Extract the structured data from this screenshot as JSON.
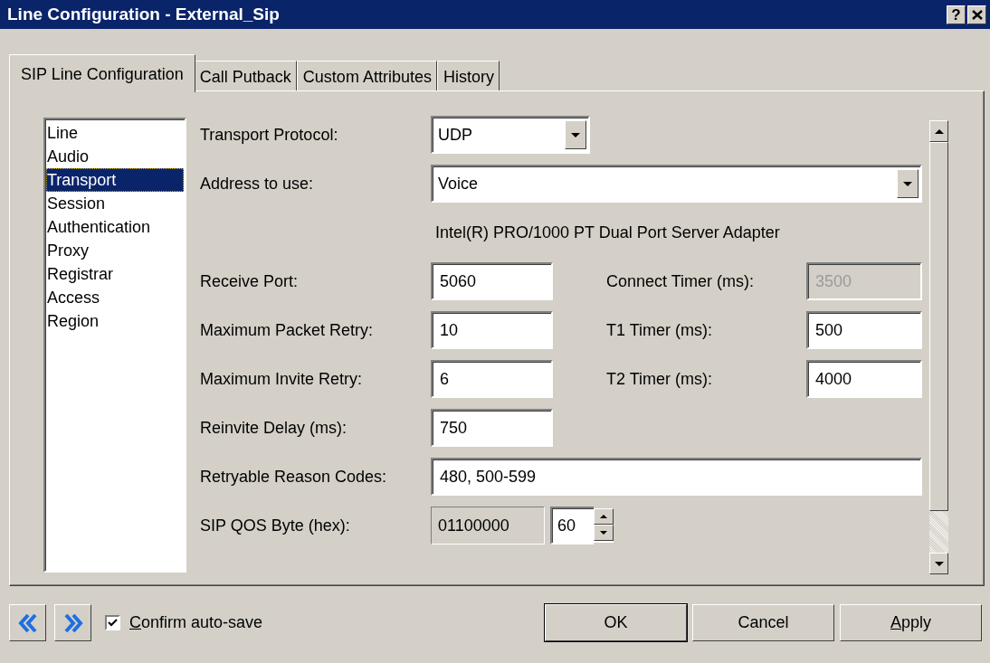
{
  "window": {
    "title": "Line Configuration - External_Sip",
    "help_button": "?"
  },
  "tabs": [
    {
      "label": "SIP Line Configuration",
      "selected": true
    },
    {
      "label": "Call Putback",
      "selected": false
    },
    {
      "label": "Custom Attributes",
      "selected": false
    },
    {
      "label": "History",
      "selected": false
    }
  ],
  "sections": [
    {
      "label": "Line",
      "selected": false
    },
    {
      "label": "Audio",
      "selected": false
    },
    {
      "label": "Transport",
      "selected": true
    },
    {
      "label": "Session",
      "selected": false
    },
    {
      "label": "Authentication",
      "selected": false
    },
    {
      "label": "Proxy",
      "selected": false
    },
    {
      "label": "Registrar",
      "selected": false
    },
    {
      "label": "Access",
      "selected": false
    },
    {
      "label": "Region",
      "selected": false
    }
  ],
  "form_rows": [
    {
      "fields": [
        {
          "kind": "dropdown",
          "label": "Transport Protocol:",
          "value": "UDP"
        }
      ]
    },
    {
      "fields": [
        {
          "kind": "wide_dropdown",
          "label": "Address to use:",
          "value": "Voice"
        }
      ]
    },
    {
      "fields": [
        {
          "kind": "note",
          "value": "Intel(R) PRO/1000 PT Dual Port Server Adapter"
        }
      ]
    },
    {
      "fields": [
        {
          "kind": "input",
          "label": "Receive Port:",
          "value": "5060",
          "disabled": false
        },
        {
          "kind": "input",
          "label": "Connect Timer (ms):",
          "value": "3500",
          "disabled": true
        }
      ]
    },
    {
      "fields": [
        {
          "kind": "input",
          "label": "Maximum Packet Retry:",
          "value": "10",
          "disabled": false
        },
        {
          "kind": "input",
          "label": "T1 Timer (ms):",
          "value": "500",
          "disabled": false
        }
      ]
    },
    {
      "fields": [
        {
          "kind": "input",
          "label": "Maximum Invite Retry:",
          "value": "6",
          "disabled": false
        },
        {
          "kind": "input",
          "label": "T2 Timer (ms):",
          "value": "4000",
          "disabled": false
        }
      ]
    },
    {
      "fields": [
        {
          "kind": "input",
          "label": "Reinvite Delay (ms):",
          "value": "750",
          "disabled": false
        }
      ]
    },
    {
      "fields": [
        {
          "kind": "wide_input",
          "label": "Retryable Reason Codes:",
          "value": "480, 500-599",
          "disabled": false
        }
      ]
    },
    {
      "fields": [
        {
          "kind": "qos",
          "label": "SIP QOS Byte (hex):",
          "readout": "01100000",
          "value": "60"
        }
      ]
    }
  ],
  "footer": {
    "confirm_autosave": {
      "label": "Confirm auto-save",
      "checked": true,
      "mnemonic": true
    },
    "buttons": [
      {
        "label": "OK",
        "default": true,
        "mnemonic": false
      },
      {
        "label": "Cancel",
        "default": false,
        "mnemonic": false
      },
      {
        "label": "Apply",
        "default": false,
        "mnemonic": true
      }
    ]
  }
}
